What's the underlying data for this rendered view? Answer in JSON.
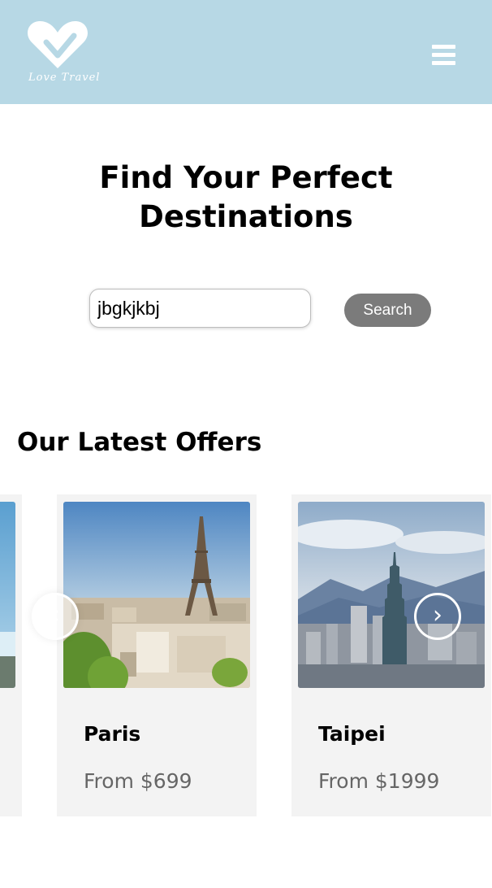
{
  "header": {
    "logo_text": "Love Travel",
    "logo_icon": "heart-icon",
    "menu_icon": "hamburger-menu-icon",
    "background_color": "#b7d8e5"
  },
  "hero": {
    "title_line1": "Find Your Perfect",
    "title_line2": "Destinations"
  },
  "search": {
    "value": "jbgkjkbj",
    "button_label": "Search"
  },
  "offers": {
    "title": "Our Latest Offers",
    "cards": [
      {
        "city": "",
        "price": ""
      },
      {
        "city": "Paris",
        "price": "From $699"
      },
      {
        "city": "Taipei",
        "price": "From $1999"
      }
    ],
    "prev_label": "‹",
    "next_label": "›"
  }
}
